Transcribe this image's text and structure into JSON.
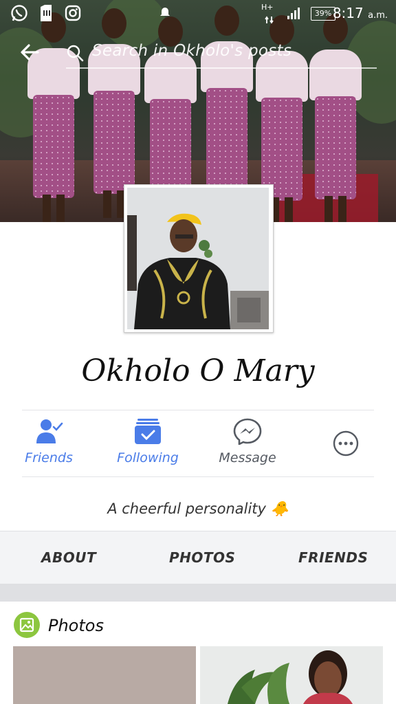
{
  "status_bar": {
    "time": "8:17",
    "ampm": "a.m.",
    "battery": "39%",
    "network": "H+",
    "icons": [
      "whatsapp-icon",
      "sim-icon",
      "instagram-icon",
      "notification-icon"
    ]
  },
  "search": {
    "placeholder": "Search in Okholo's posts"
  },
  "profile": {
    "name": "Okholo O Mary",
    "bio": "A cheerful personality",
    "bio_emoji": "🐥"
  },
  "actions": {
    "friends": "Friends",
    "following": "Following",
    "message": "Message"
  },
  "tabs": [
    "ABOUT",
    "PHOTOS",
    "FRIENDS"
  ],
  "photos_section": {
    "title": "Photos"
  },
  "colors": {
    "accent_blue": "#4a7ce8",
    "photos_green": "#8cc63f",
    "grey_text": "#555a62"
  }
}
